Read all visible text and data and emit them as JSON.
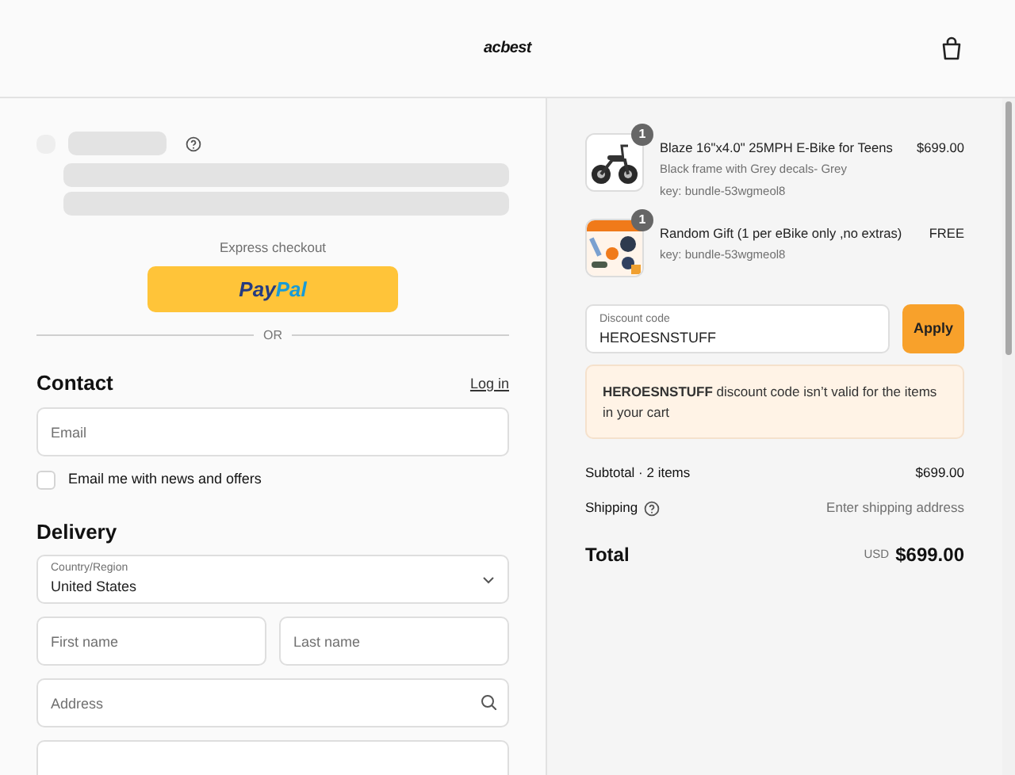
{
  "header": {
    "logo": "acbest"
  },
  "express": {
    "label": "Express checkout",
    "paypal_parts": [
      "Pay",
      "Pal"
    ],
    "separator": "OR"
  },
  "contact": {
    "heading": "Contact",
    "login_link": "Log in",
    "email_placeholder": "Email",
    "newsletter": {
      "label": "Email me with news and offers",
      "checked": false
    }
  },
  "delivery": {
    "heading": "Delivery",
    "country": {
      "label": "Country/Region",
      "value": "United States"
    },
    "first_name_placeholder": "First name",
    "last_name_placeholder": "Last name",
    "address_placeholder": "Address"
  },
  "order_items": [
    {
      "quantity": "1",
      "title": "Blaze 16\"x4.0\" 25MPH E-Bike for Teens",
      "variant": "Black frame with Grey decals- Grey",
      "key": "key: bundle-53wgmeol8",
      "price": "$699.00"
    },
    {
      "quantity": "1",
      "title": "Random Gift (1 per eBike only ,no extras)",
      "key": "key: bundle-53wgmeol8",
      "price": "FREE"
    }
  ],
  "discount": {
    "label": "Discount code",
    "value": "HEROESNSTUFF",
    "apply": "Apply",
    "error": "**HEROESNSTUFF** discount code isn’t valid for the items in your cart"
  },
  "summary": {
    "subtotal_label": "Subtotal · 2 items",
    "subtotal": "$699.00",
    "shipping_label": "Shipping",
    "shipping": "Enter shipping address",
    "total_label": "Total",
    "currency": "USD",
    "total": "$699.00"
  }
}
